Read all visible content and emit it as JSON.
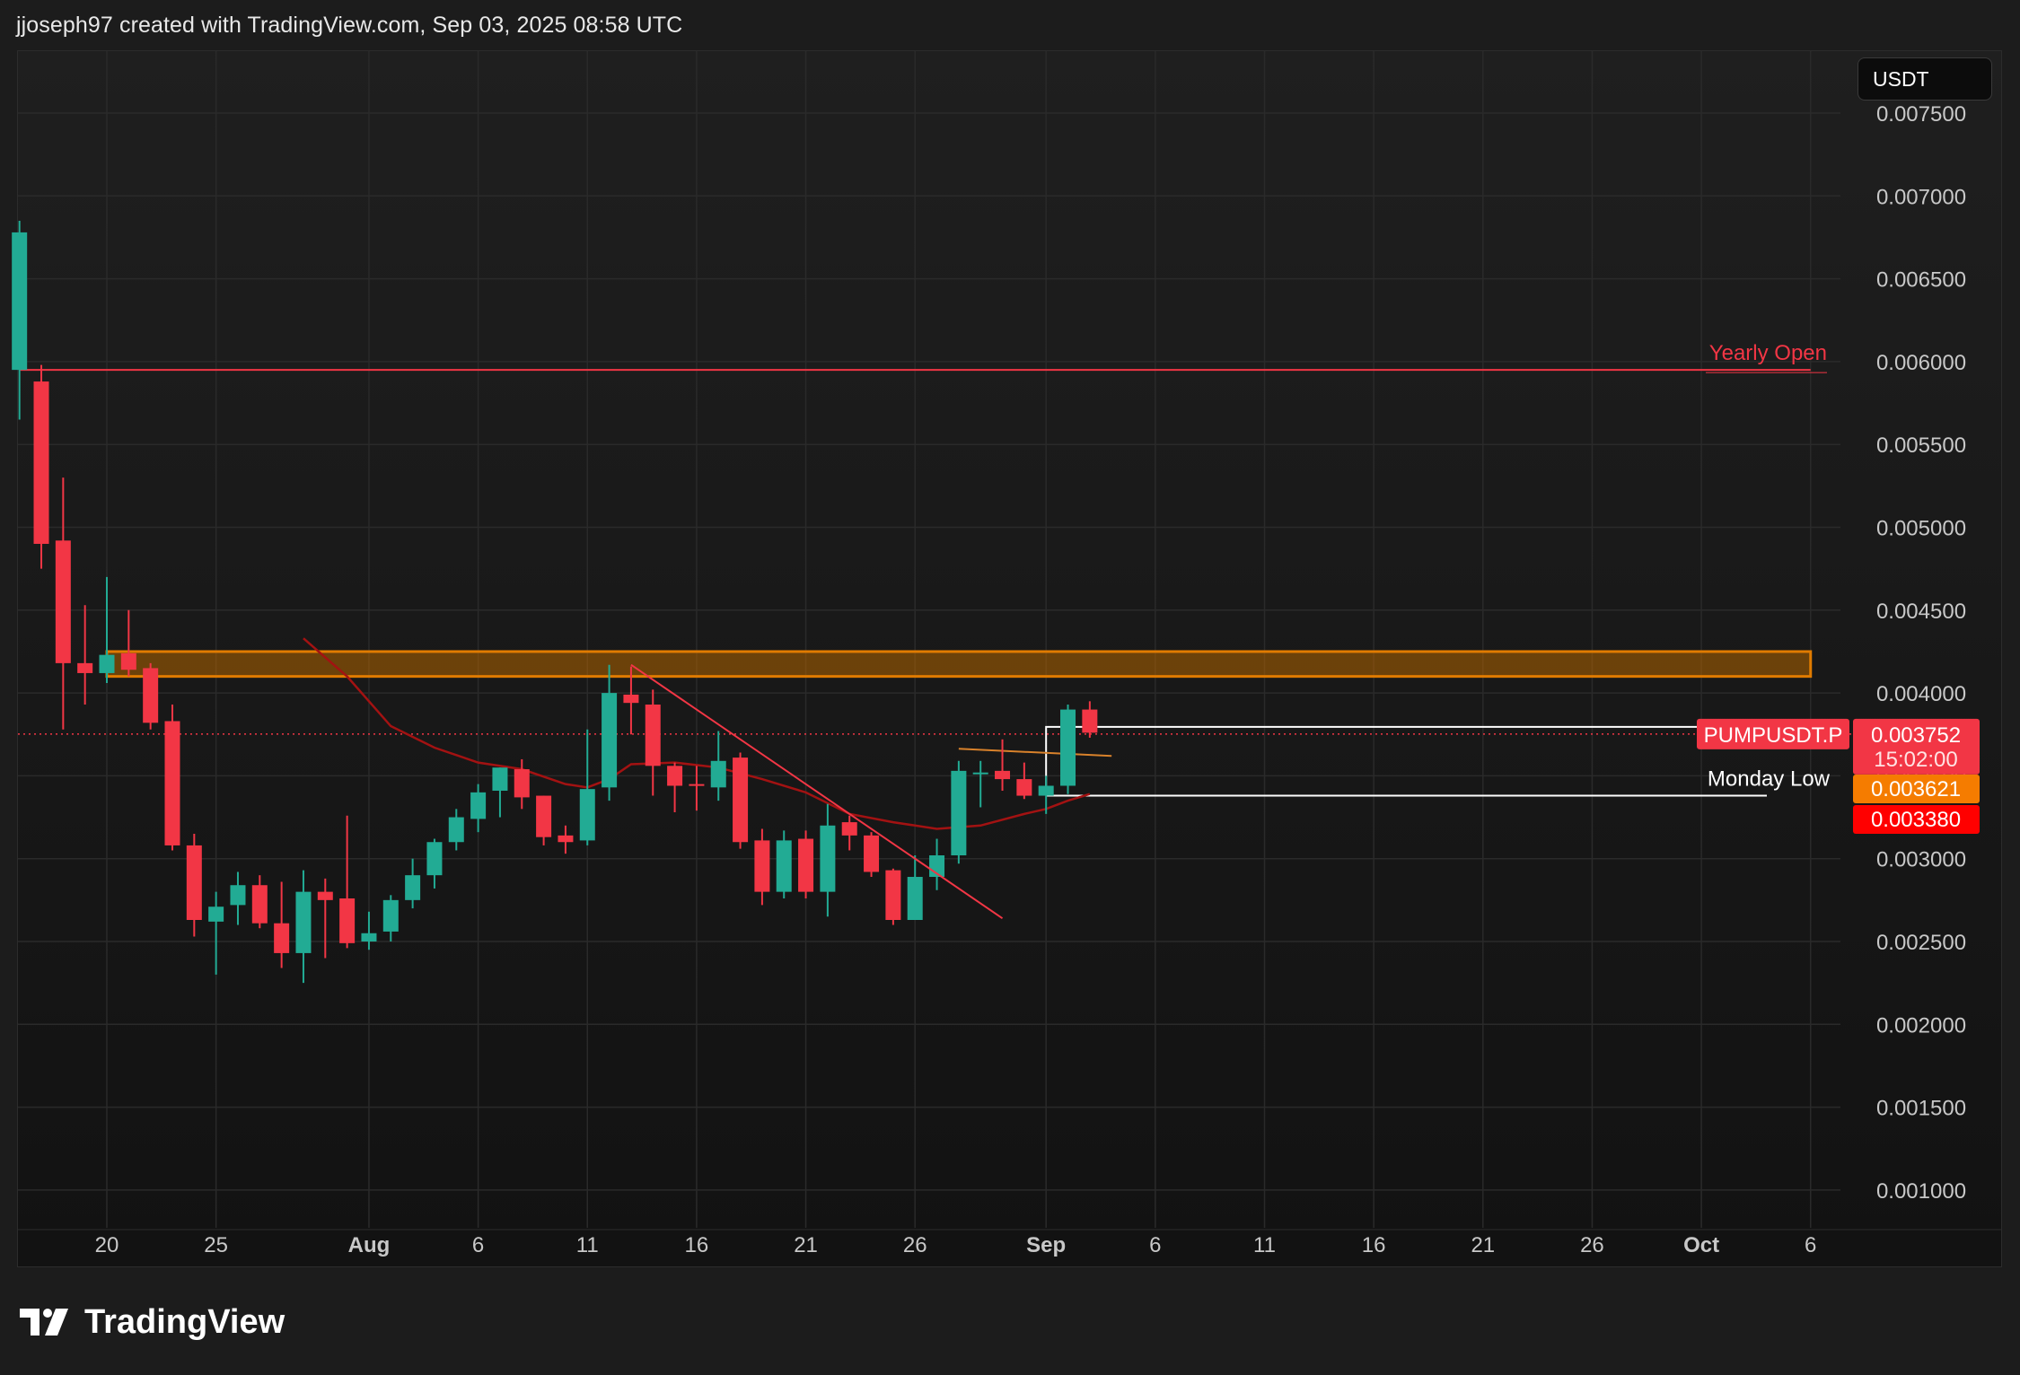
{
  "header": {
    "attribution": "jjoseph97 created with TradingView.com, Sep 03, 2025 08:58 UTC"
  },
  "currency_button": {
    "label": "USDT"
  },
  "footer": {
    "brand": "TradingView"
  },
  "colors": {
    "up": "#22ab94",
    "down": "#f23645",
    "grid": "#2a2a2a",
    "yearly_open": "#f23645",
    "zone": "#b26400",
    "ma": "#a31212",
    "trendline": "#f23645"
  },
  "chart_data": {
    "type": "candlestick",
    "symbol": "PUMPUSDT.P",
    "y_axis": {
      "min": 0.0008,
      "max": 0.0078,
      "ticks": [
        "0.007500",
        "0.007000",
        "0.006500",
        "0.006000",
        "0.005500",
        "0.005000",
        "0.004500",
        "0.004000",
        "0.003500",
        "0.003000",
        "0.002500",
        "0.002000",
        "0.001500",
        "0.001000"
      ]
    },
    "x_axis": {
      "ticks": [
        {
          "label": "20",
          "day": 20
        },
        {
          "label": "25",
          "day": 25
        },
        {
          "label": "Aug",
          "day": 32,
          "bold": true
        },
        {
          "label": "6",
          "day": 37
        },
        {
          "label": "11",
          "day": 42
        },
        {
          "label": "16",
          "day": 47
        },
        {
          "label": "21",
          "day": 52
        },
        {
          "label": "26",
          "day": 57
        },
        {
          "label": "Sep",
          "day": 63,
          "bold": true
        },
        {
          "label": "6",
          "day": 68
        },
        {
          "label": "11",
          "day": 73
        },
        {
          "label": "16",
          "day": 78
        },
        {
          "label": "21",
          "day": 83
        },
        {
          "label": "26",
          "day": 88
        },
        {
          "label": "Oct",
          "day": 93,
          "bold": true
        },
        {
          "label": "6",
          "day": 98
        }
      ]
    },
    "candles": [
      {
        "day": 16,
        "o": 0.00595,
        "h": 0.00685,
        "l": 0.00565,
        "c": 0.00678
      },
      {
        "day": 17,
        "o": 0.00588,
        "h": 0.00598,
        "l": 0.00475,
        "c": 0.0049
      },
      {
        "day": 18,
        "o": 0.00492,
        "h": 0.0053,
        "l": 0.00378,
        "c": 0.00418
      },
      {
        "day": 19,
        "o": 0.00418,
        "h": 0.00453,
        "l": 0.00393,
        "c": 0.00412
      },
      {
        "day": 20,
        "o": 0.00412,
        "h": 0.0047,
        "l": 0.00406,
        "c": 0.00423
      },
      {
        "day": 21,
        "o": 0.00424,
        "h": 0.0045,
        "l": 0.0041,
        "c": 0.00414
      },
      {
        "day": 22,
        "o": 0.00415,
        "h": 0.00418,
        "l": 0.00378,
        "c": 0.00382
      },
      {
        "day": 23,
        "o": 0.00383,
        "h": 0.00393,
        "l": 0.00305,
        "c": 0.00308
      },
      {
        "day": 24,
        "o": 0.00308,
        "h": 0.00315,
        "l": 0.00253,
        "c": 0.00263
      },
      {
        "day": 25,
        "o": 0.00262,
        "h": 0.0028,
        "l": 0.0023,
        "c": 0.00271
      },
      {
        "day": 26,
        "o": 0.00272,
        "h": 0.00292,
        "l": 0.0026,
        "c": 0.00284
      },
      {
        "day": 27,
        "o": 0.00284,
        "h": 0.0029,
        "l": 0.00258,
        "c": 0.00261
      },
      {
        "day": 28,
        "o": 0.00261,
        "h": 0.00286,
        "l": 0.00234,
        "c": 0.00243
      },
      {
        "day": 29,
        "o": 0.00243,
        "h": 0.00293,
        "l": 0.00225,
        "c": 0.0028
      },
      {
        "day": 30,
        "o": 0.0028,
        "h": 0.00288,
        "l": 0.0024,
        "c": 0.00275
      },
      {
        "day": 31,
        "o": 0.00276,
        "h": 0.00326,
        "l": 0.00246,
        "c": 0.00249
      },
      {
        "day": 32,
        "o": 0.0025,
        "h": 0.00268,
        "l": 0.00245,
        "c": 0.00255
      },
      {
        "day": 33,
        "o": 0.00256,
        "h": 0.00278,
        "l": 0.0025,
        "c": 0.00275
      },
      {
        "day": 34,
        "o": 0.00275,
        "h": 0.003,
        "l": 0.0027,
        "c": 0.0029
      },
      {
        "day": 35,
        "o": 0.0029,
        "h": 0.00312,
        "l": 0.00282,
        "c": 0.0031
      },
      {
        "day": 36,
        "o": 0.0031,
        "h": 0.0033,
        "l": 0.00305,
        "c": 0.00325
      },
      {
        "day": 37,
        "o": 0.00324,
        "h": 0.00345,
        "l": 0.00316,
        "c": 0.0034
      },
      {
        "day": 38,
        "o": 0.00341,
        "h": 0.00355,
        "l": 0.00325,
        "c": 0.00355
      },
      {
        "day": 39,
        "o": 0.00354,
        "h": 0.0036,
        "l": 0.0033,
        "c": 0.00337
      },
      {
        "day": 40,
        "o": 0.00338,
        "h": 0.00338,
        "l": 0.00308,
        "c": 0.00313
      },
      {
        "day": 41,
        "o": 0.00314,
        "h": 0.0032,
        "l": 0.00303,
        "c": 0.0031
      },
      {
        "day": 42,
        "o": 0.00311,
        "h": 0.00378,
        "l": 0.00308,
        "c": 0.00342
      },
      {
        "day": 43,
        "o": 0.00343,
        "h": 0.00417,
        "l": 0.00335,
        "c": 0.004
      },
      {
        "day": 44,
        "o": 0.00399,
        "h": 0.00416,
        "l": 0.00375,
        "c": 0.00394
      },
      {
        "day": 45,
        "o": 0.00393,
        "h": 0.00402,
        "l": 0.00338,
        "c": 0.00356
      },
      {
        "day": 46,
        "o": 0.00356,
        "h": 0.00358,
        "l": 0.00328,
        "c": 0.00344
      },
      {
        "day": 47,
        "o": 0.00345,
        "h": 0.00356,
        "l": 0.00329,
        "c": 0.00344
      },
      {
        "day": 48,
        "o": 0.00343,
        "h": 0.00377,
        "l": 0.00335,
        "c": 0.00359
      },
      {
        "day": 49,
        "o": 0.00361,
        "h": 0.00364,
        "l": 0.00306,
        "c": 0.0031
      },
      {
        "day": 50,
        "o": 0.00311,
        "h": 0.00318,
        "l": 0.00272,
        "c": 0.0028
      },
      {
        "day": 51,
        "o": 0.0028,
        "h": 0.00317,
        "l": 0.00276,
        "c": 0.00311
      },
      {
        "day": 52,
        "o": 0.00312,
        "h": 0.00317,
        "l": 0.00276,
        "c": 0.0028
      },
      {
        "day": 53,
        "o": 0.0028,
        "h": 0.00333,
        "l": 0.00265,
        "c": 0.0032
      },
      {
        "day": 54,
        "o": 0.00322,
        "h": 0.00326,
        "l": 0.00305,
        "c": 0.00314
      },
      {
        "day": 55,
        "o": 0.00314,
        "h": 0.00316,
        "l": 0.00289,
        "c": 0.00292
      },
      {
        "day": 56,
        "o": 0.00293,
        "h": 0.00294,
        "l": 0.0026,
        "c": 0.00263
      },
      {
        "day": 57,
        "o": 0.00263,
        "h": 0.00302,
        "l": 0.00263,
        "c": 0.00289
      },
      {
        "day": 58,
        "o": 0.00289,
        "h": 0.00312,
        "l": 0.00281,
        "c": 0.00302
      },
      {
        "day": 59,
        "o": 0.00302,
        "h": 0.00359,
        "l": 0.00297,
        "c": 0.00353
      },
      {
        "day": 60,
        "o": 0.00351,
        "h": 0.00359,
        "l": 0.00331,
        "c": 0.00352
      },
      {
        "day": 61,
        "o": 0.00353,
        "h": 0.00372,
        "l": 0.00341,
        "c": 0.00348
      },
      {
        "day": 62,
        "o": 0.00348,
        "h": 0.00358,
        "l": 0.00336,
        "c": 0.00338
      },
      {
        "day": 63,
        "o": 0.00338,
        "h": 0.0035,
        "l": 0.00327,
        "c": 0.00344
      },
      {
        "day": 64,
        "o": 0.00344,
        "h": 0.00393,
        "l": 0.00339,
        "c": 0.0039
      },
      {
        "day": 65,
        "o": 0.0039,
        "h": 0.00395,
        "l": 0.00373,
        "c": 0.00376
      }
    ],
    "moving_average": [
      {
        "day": 29,
        "v": 0.00433
      },
      {
        "day": 31,
        "v": 0.0041
      },
      {
        "day": 33,
        "v": 0.0038
      },
      {
        "day": 35,
        "v": 0.00367
      },
      {
        "day": 37,
        "v": 0.00358
      },
      {
        "day": 39,
        "v": 0.00354
      },
      {
        "day": 41,
        "v": 0.00345
      },
      {
        "day": 42,
        "v": 0.00343
      },
      {
        "day": 43,
        "v": 0.00348
      },
      {
        "day": 44,
        "v": 0.00357
      },
      {
        "day": 46,
        "v": 0.00358
      },
      {
        "day": 48,
        "v": 0.00355
      },
      {
        "day": 50,
        "v": 0.00348
      },
      {
        "day": 52,
        "v": 0.0034
      },
      {
        "day": 54,
        "v": 0.00327
      },
      {
        "day": 56,
        "v": 0.00322
      },
      {
        "day": 58,
        "v": 0.00318
      },
      {
        "day": 60,
        "v": 0.0032
      },
      {
        "day": 62,
        "v": 0.00327
      },
      {
        "day": 63,
        "v": 0.0033
      },
      {
        "day": 64,
        "v": 0.00335
      },
      {
        "day": 65,
        "v": 0.00339
      }
    ],
    "trendline": {
      "from": {
        "day": 44,
        "v": 0.00417
      },
      "to": {
        "day": 61,
        "v": 0.00264
      }
    },
    "resistance_zone": {
      "from_day": 20,
      "to_day": 98,
      "top": 0.00425,
      "bottom": 0.0041
    },
    "levels": [
      {
        "name": "Yearly Open",
        "value": 0.00595,
        "from_day": 16,
        "to_day": 98
      },
      {
        "name": "Monday Low",
        "value": 0.00338,
        "from_day": 63,
        "to_day": 98
      }
    ],
    "weekly_open": {
      "value": 0.003752,
      "from_day": 63,
      "to_day": 93
    },
    "ma_short": {
      "from_day": 59,
      "to_day": 66,
      "v0": 0.00362,
      "v1": 0.00362
    },
    "current_price": {
      "value": 0.003752,
      "countdown": "15:02:00"
    },
    "price_labels": [
      {
        "value": "0.003752",
        "sub": "15:02:00",
        "color": "#f23645"
      },
      {
        "value": "0.003621",
        "color": "#f57c00"
      },
      {
        "value": "0.003380",
        "color": "#ff0000"
      }
    ]
  }
}
